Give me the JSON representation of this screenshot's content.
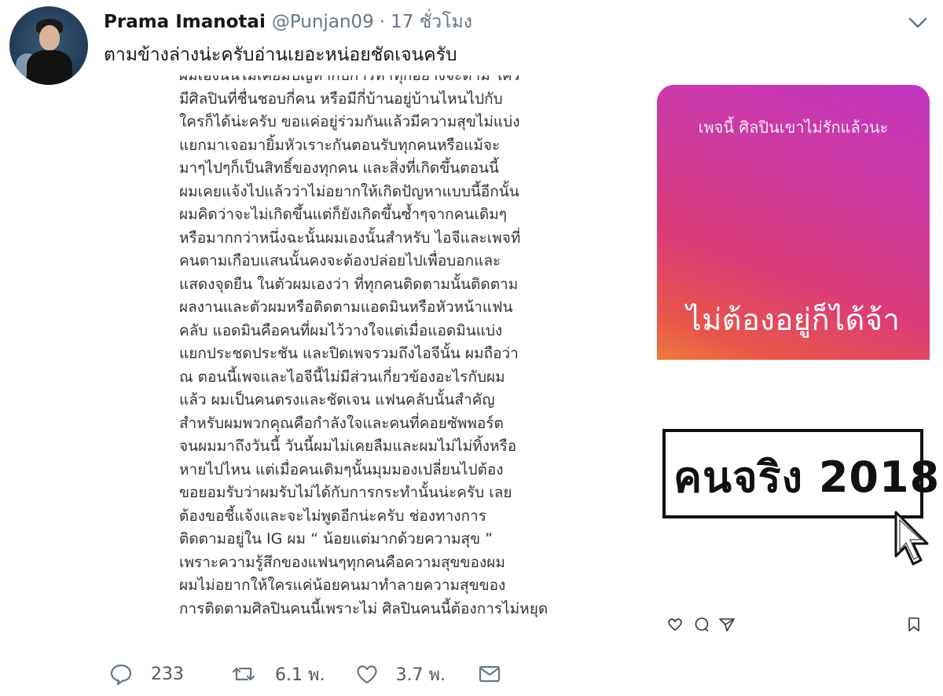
{
  "tweet": {
    "display_name": "Prama Imanotai",
    "handle": "@Punjan09",
    "separator": "·",
    "time": "17 ชั่วโมง",
    "text": "ตามข้างล่างน่ะครับอ่านเยอะหน่อยชัดเจนครับ"
  },
  "media": {
    "statement_lines": [
      "ผมเองนั้นไม่เคยมีปัญหากับการทำทุกอย่างจะตาม ใคร",
      "มีศิลปินที่ชื่นชอบกี่คน หรือมีกี่บ้านอยู่บ้านไหนไปกับ",
      "ใครก็ได้น่ะครับ ขอแค่อยู่ร่วมกันแล้วมีความสุขไม่แบ่ง",
      "แยกมาเจอมายิ้มหัวเราะกันตอนรับทุกคนหรือแม้จะ",
      "มาๆไปๆก็เป็นสิทธิ์ของทุกคน และสิ่งที่เกิดขึ้นตอนนี้",
      "ผมเคยแจ้งไปแล้วว่าไม่อยากให้เกิดปัญหาแบบนี้อีกนั้น",
      "ผมคิดว่าจะไม่เกิดขึ้นแต่ก็ยังเกิดขึ้นซ้ำๆจากคนเดิมๆ",
      "หรือมากกว่าหนึ่งฉะนั้นผมเองนั้นสำหรับ ไอจีและเพจที่",
      "คนตามเกือบแสนนั้นคงจะต้องปล่อยไปเพื่อบอกและ",
      "แสดงจุดยืน ในตัวผมเองว่า ที่ทุกคนติดตามนั้นติดตาม",
      "ผลงานและตัวผมหรือติดตามแอดมินหรือหัวหน้าแฟน",
      "คลับ แอดมินคือคนที่ผมไว้วางใจแต่เมื่อแอดมินแบ่ง",
      "แยกประชดประชัน และปิดเพจรวมถึงไอจีนั้น ผมถือว่า",
      "ณ ตอนนี้เพจและไอจีนี้ไม่มีส่วนเกี่ยวข้องอะไรกับผม",
      "แล้ว ผมเป็นคนตรงและชัดเจน แฟนคลับนั้นสำคัญ",
      "สำหรับผมพวกคุณคือกำลังใจและคนที่คอยซัพพอร์ต",
      "จนผมมาถึงวันนี้ วันนี้ผมไม่เคยลืมและผมไม่ไม่ทิ้งหรือ",
      "หายไปไหน แต่เมื่อคนเดิมๆนั้นมุมมองเปลี่ยนไปต้อง",
      "ขอยอมรับว่าผมรับไม่ได้กับการกระทำนั้นน่ะครับ เลย",
      "ต้องขอชี้แจ้งและจะไม่พูดอีกน่ะครับ ช่องทางการ",
      "ติดตามอยู่ใน IG ผม “ น้อยแต่มากด้วยความสุข ”",
      "เพราะความรู้สึกของแฟนๆทุกคนคือความสุขของผม",
      "ผมไม่อยากให้ใครแค่น้อยคนมาทำลายความสุขของ",
      "การติดตามศิลปินคนนี้เพราะไม่ ศิลปินคนนี้ต้องการไม่หยุด"
    ],
    "story_small_text": "เพจนี้ ศิลปินเขาไม่รักแล้วนะ",
    "story_big_text": "ไม่ต้องอยู่ก็ได้จ้า",
    "sign_text": "คนจริง 2018",
    "icons": [
      "heart-icon",
      "comment-icon",
      "send-icon",
      "bookmark-icon",
      "cursor-icon"
    ]
  },
  "actions": {
    "replies": "233",
    "retweets": "6.1 พ.",
    "likes": "3.7 พ."
  },
  "colors": {
    "text": "#14171a",
    "muted": "#657786",
    "story_gradient_start": "#c435c1",
    "story_gradient_end": "#ef7a3a"
  }
}
